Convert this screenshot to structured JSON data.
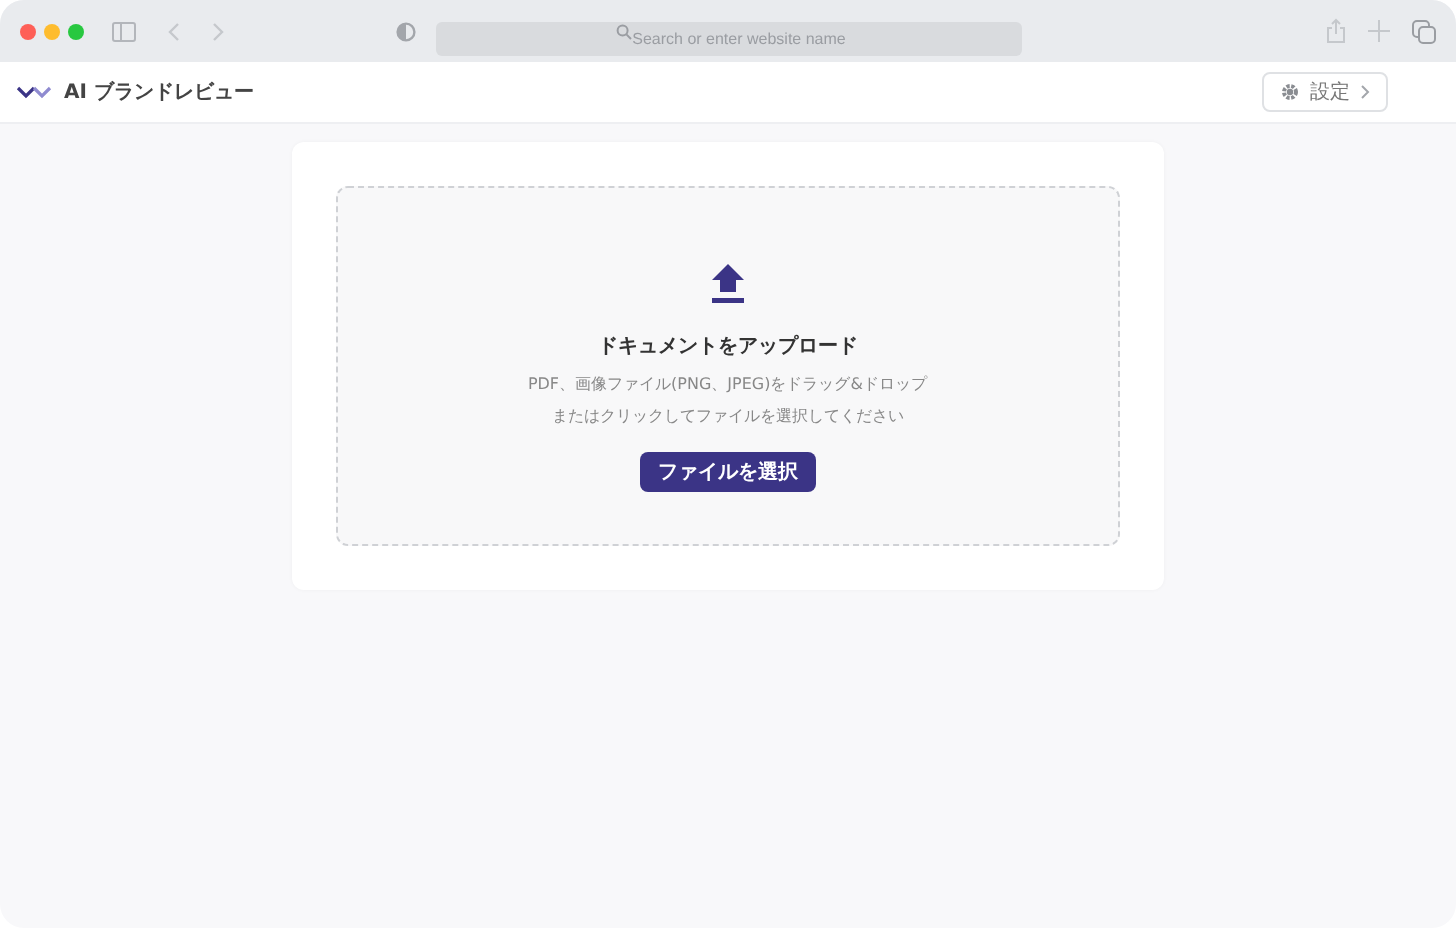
{
  "browser": {
    "address_placeholder": "Search or enter website name"
  },
  "header": {
    "title": "AI ブランドレビュー",
    "settings_label": "設定"
  },
  "upload": {
    "heading": "ドキュメントをアップロード",
    "description_lines": [
      "PDF、画像ファイル(PNG、JPEG)をドラッグ&ドロップ",
      "またはクリックしてファイルを選択してください"
    ],
    "button": "ファイルを選択"
  }
}
